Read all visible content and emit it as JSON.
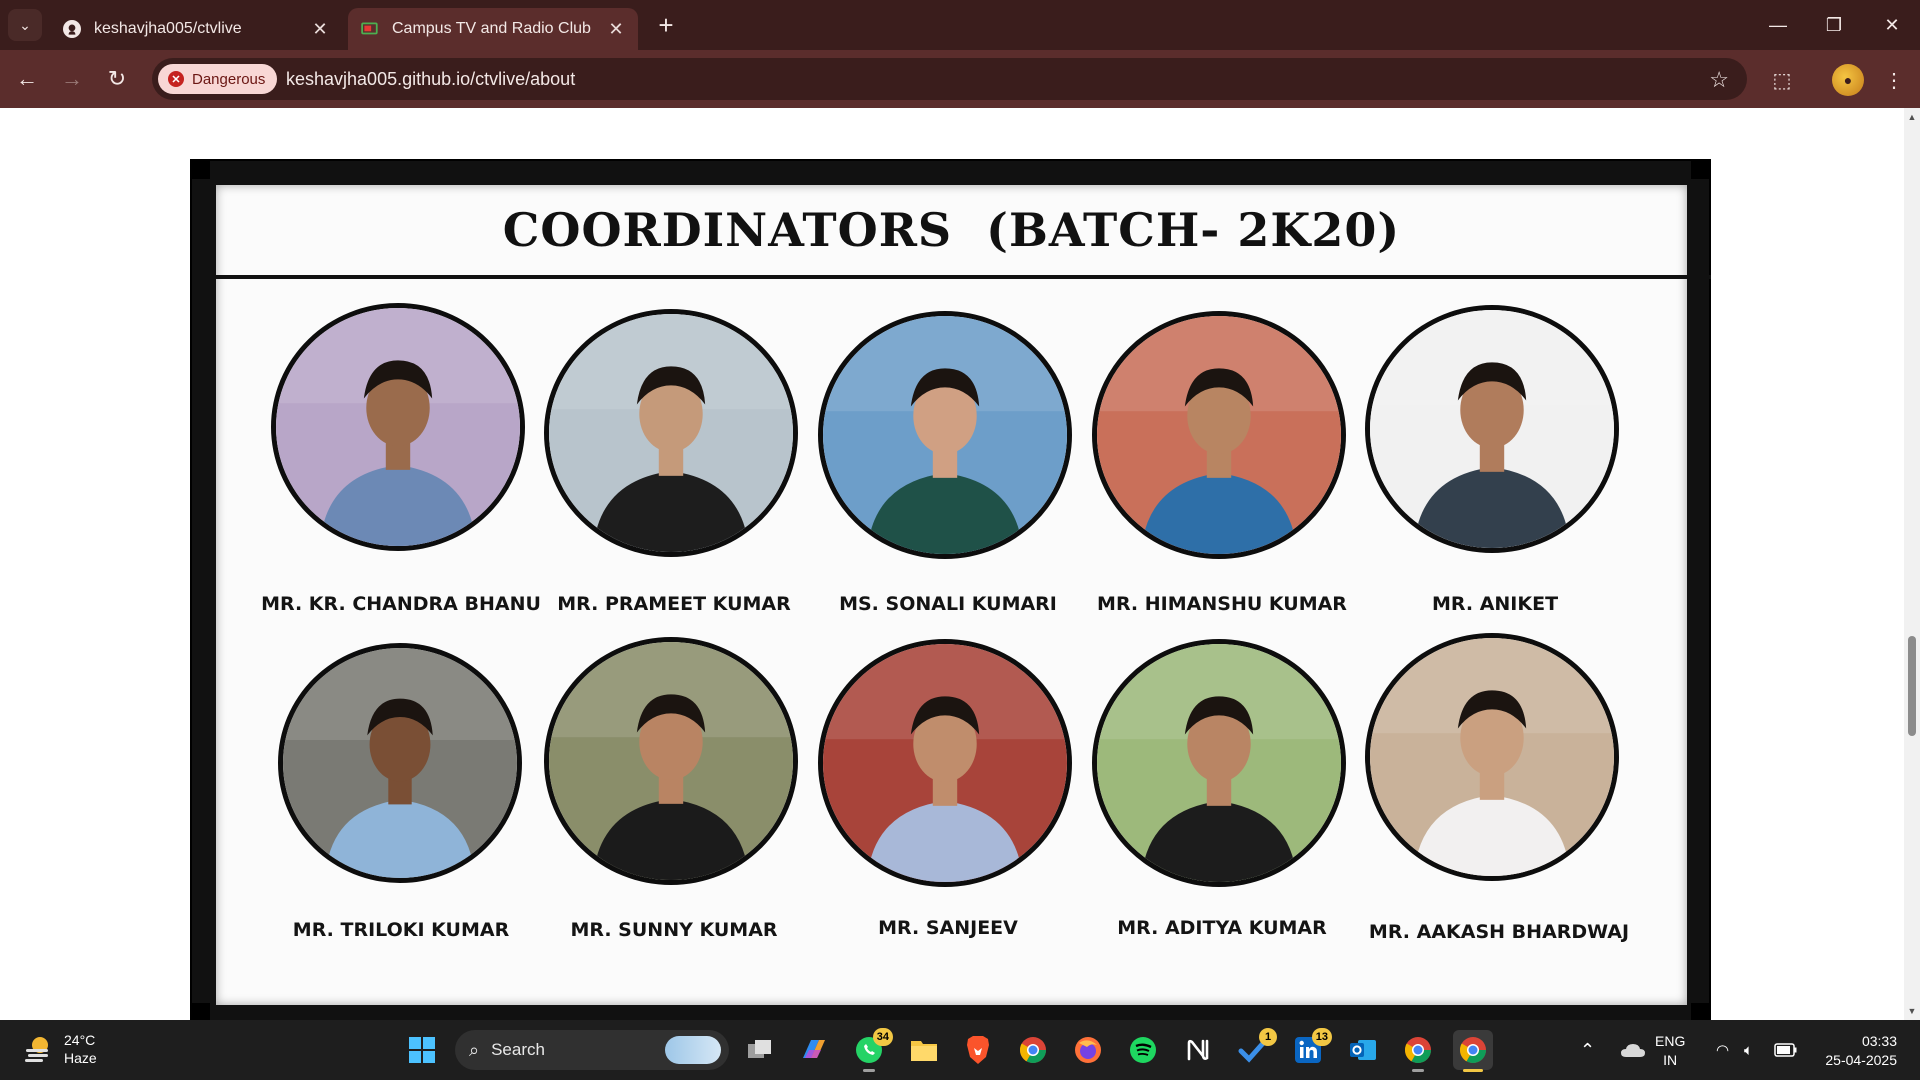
{
  "browser": {
    "tabs": [
      {
        "title": "keshavjha005/ctvlive",
        "icon": "github-icon",
        "active": false
      },
      {
        "title": "Campus TV and Radio Club",
        "icon": "club-tv-icon",
        "active": true
      }
    ],
    "security_chip": "Dangerous",
    "url": "keshavjha005.github.io/ctvlive/about"
  },
  "page": {
    "heading": "COORDINATORS  (BATCH- 2K20)",
    "coordinators": [
      {
        "name": "MR. KR. CHANDRA BHANU",
        "bg": "#b8a6c8",
        "shirt": "#6c89b5",
        "skin": "#9a6b4c"
      },
      {
        "name": "MR. PRAMEET KUMAR",
        "bg": "#b8c4cc",
        "shirt": "#1d1d1d",
        "skin": "#c59a7a"
      },
      {
        "name": "MS. SONALI KUMARI",
        "bg": "#6d9ec9",
        "shirt": "#1f5148",
        "skin": "#d0a083"
      },
      {
        "name": "MR. HIMANSHU KUMAR",
        "bg": "#c9705a",
        "shirt": "#2e6fa8",
        "skin": "#b88562"
      },
      {
        "name": "MR. ANIKET",
        "bg": "#f1f1f1",
        "shirt": "#33404d",
        "skin": "#b07c5c"
      },
      {
        "name": "MR. TRILOKI KUMAR",
        "bg": "#7a7a74",
        "shirt": "#8fb4d8",
        "skin": "#7a4f35"
      },
      {
        "name": "MR. SUNNY KUMAR",
        "bg": "#8a8e6a",
        "shirt": "#1b1b1b",
        "skin": "#b98463"
      },
      {
        "name": "MR. SANJEEV",
        "bg": "#a8443a",
        "shirt": "#a8b8d8",
        "skin": "#c08d6c"
      },
      {
        "name": "MR. ADITYA KUMAR",
        "bg": "#9db97b",
        "shirt": "#1c1c1c",
        "skin": "#b98564"
      },
      {
        "name": "MR. AAKASH BHARDWAJ",
        "bg": "#c9b29a",
        "shirt": "#f2f0f0",
        "skin": "#caa080"
      }
    ]
  },
  "taskbar": {
    "weather_temp": "24°C",
    "weather_desc": "Haze",
    "search_placeholder": "Search",
    "badges": {
      "whatsapp": "34",
      "todo": "1",
      "linkedin": "13"
    },
    "lang_line1": "ENG",
    "lang_line2": "IN",
    "time": "03:33",
    "date": "25-04-2025"
  },
  "colors": {
    "chrome_dark": "#3a1d1c",
    "chrome_toolbar": "#5b2d2c",
    "danger": "#c5221f"
  }
}
